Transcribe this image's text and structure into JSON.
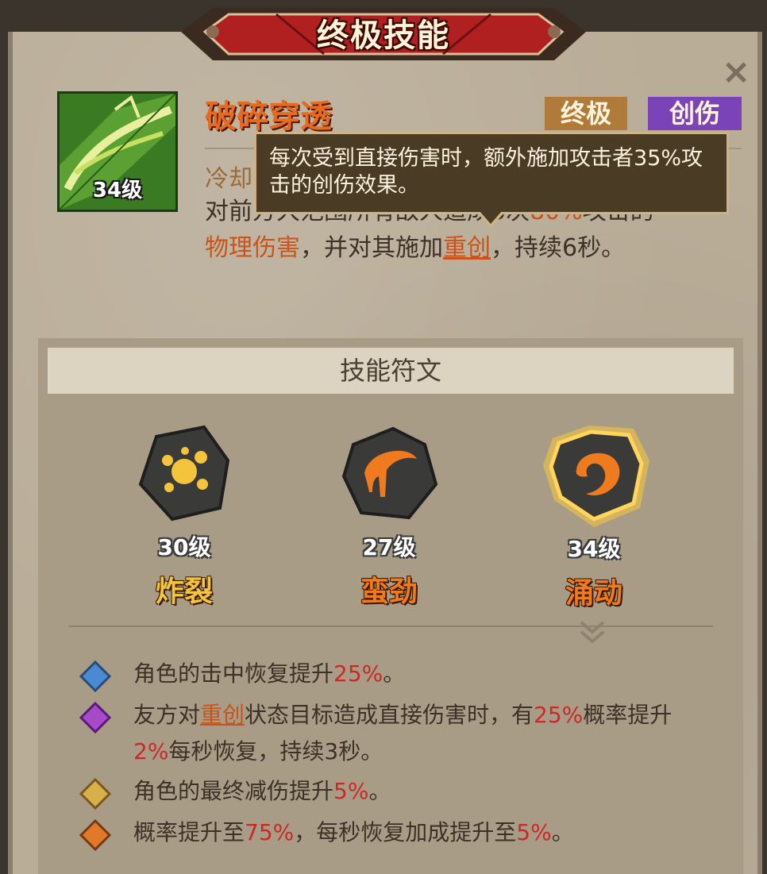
{
  "title": "终极技能",
  "close_icon": "×",
  "skill": {
    "name": "破碎穿透",
    "level": "34级",
    "tags": [
      "终极",
      "创伤"
    ],
    "cooldown_prefix": "冷却",
    "desc_parts": {
      "line1_a": "对前方大范围所有敌人造成3次",
      "line1_pct": "80%",
      "line1_b": "攻击的",
      "line2_hl": "物理伤害",
      "line2_a": "，并对其施加",
      "line2_ul": "重创",
      "line2_b": "，持续6秒。"
    }
  },
  "tooltip": {
    "text": "每次受到直接伤害时，额外施加攻击者35%攻击的创伤效果。"
  },
  "runes": {
    "header": "技能符文",
    "items": [
      {
        "level": "30级",
        "name": "炸裂",
        "color": "#f4c53a"
      },
      {
        "level": "27级",
        "name": "蛮劲",
        "color": "#f07a1e"
      },
      {
        "level": "34级",
        "name": "涌动",
        "color": "#f07a1e"
      }
    ]
  },
  "effects": [
    {
      "gem": "blue-diamond-icon",
      "color": "#4a8ad0",
      "parts": [
        "角色的击中恢复提升",
        "25%",
        "。"
      ]
    },
    {
      "gem": "purple-diamond-icon",
      "color": "#a64ac8",
      "parts": [
        "友方对",
        "重创",
        "状态目标造成直接伤害时，有",
        "25%",
        "概率提升",
        "2%",
        "每秒恢复，持续3秒。"
      ]
    },
    {
      "gem": "gold-diamond-icon",
      "color": "#d8b04a",
      "parts": [
        "角色的最终减伤提升",
        "5%",
        "。"
      ]
    },
    {
      "gem": "orange-diamond-icon",
      "color": "#e07a2a",
      "parts": [
        "概率提升至",
        "75%",
        "，每秒恢复加成提升至",
        "5%",
        "。"
      ]
    }
  ]
}
